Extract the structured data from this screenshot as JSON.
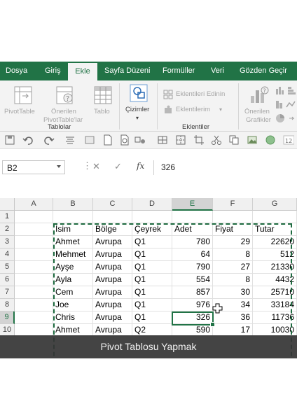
{
  "ribbon_tabs": [
    "Dosya",
    "Giriş",
    "Ekle",
    "Sayfa Düzeni",
    "Formüller",
    "Veri",
    "Gözden Geçir"
  ],
  "ribbon": {
    "tables": {
      "group_label": "Tablolar",
      "pivot_table": "PivotTable",
      "recommended_1": "Önerilen",
      "recommended_2": "PivotTable'lar",
      "table": "Tablo"
    },
    "illustrations": {
      "label": "Çizimler"
    },
    "addins": {
      "group_label": "Eklentiler",
      "get_addins": "Eklentileri Edinin",
      "my_addins": "Eklentilerim"
    },
    "charts": {
      "recommended_1": "Önerilen",
      "recommended_2": "Grafikler"
    }
  },
  "formula_bar": {
    "name_box": "B2",
    "fx": "fx",
    "value": "326"
  },
  "columns": [
    "A",
    "B",
    "C",
    "D",
    "E",
    "F",
    "G"
  ],
  "rows": [
    {
      "num": "1",
      "cells": [
        "",
        "",
        "",
        "",
        "",
        ""
      ]
    },
    {
      "num": "2",
      "cells": [
        "İsim",
        "Bölge",
        "Çeyrek",
        "Adet",
        "Fiyat",
        "Tutar"
      ]
    },
    {
      "num": "3",
      "cells": [
        "Ahmet",
        "Avrupa",
        "Q1",
        "780",
        "29",
        "22620"
      ]
    },
    {
      "num": "4",
      "cells": [
        "Mehmet",
        "Avrupa",
        "Q1",
        "64",
        "8",
        "512"
      ]
    },
    {
      "num": "5",
      "cells": [
        "Ayşe",
        "Avrupa",
        "Q1",
        "790",
        "27",
        "21330"
      ]
    },
    {
      "num": "6",
      "cells": [
        "Ayla",
        "Avrupa",
        "Q1",
        "554",
        "8",
        "4432"
      ]
    },
    {
      "num": "7",
      "cells": [
        "Cem",
        "Avrupa",
        "Q1",
        "857",
        "30",
        "25710"
      ]
    },
    {
      "num": "8",
      "cells": [
        "Joe",
        "Avrupa",
        "Q1",
        "976",
        "34",
        "33184"
      ]
    },
    {
      "num": "9",
      "cells": [
        "Chris",
        "Avrupa",
        "Q1",
        "326",
        "36",
        "11736"
      ]
    },
    {
      "num": "10",
      "cells": [
        "Ahmet",
        "Avrupa",
        "Q2",
        "590",
        "17",
        "10030"
      ]
    }
  ],
  "selected_column": "E",
  "selected_row": "9",
  "caption": "Pivot Tablosu Yapmak",
  "colors": {
    "accent": "#217346",
    "ribbon_bg": "#f3f3f3",
    "caption_bg": "#343434"
  }
}
